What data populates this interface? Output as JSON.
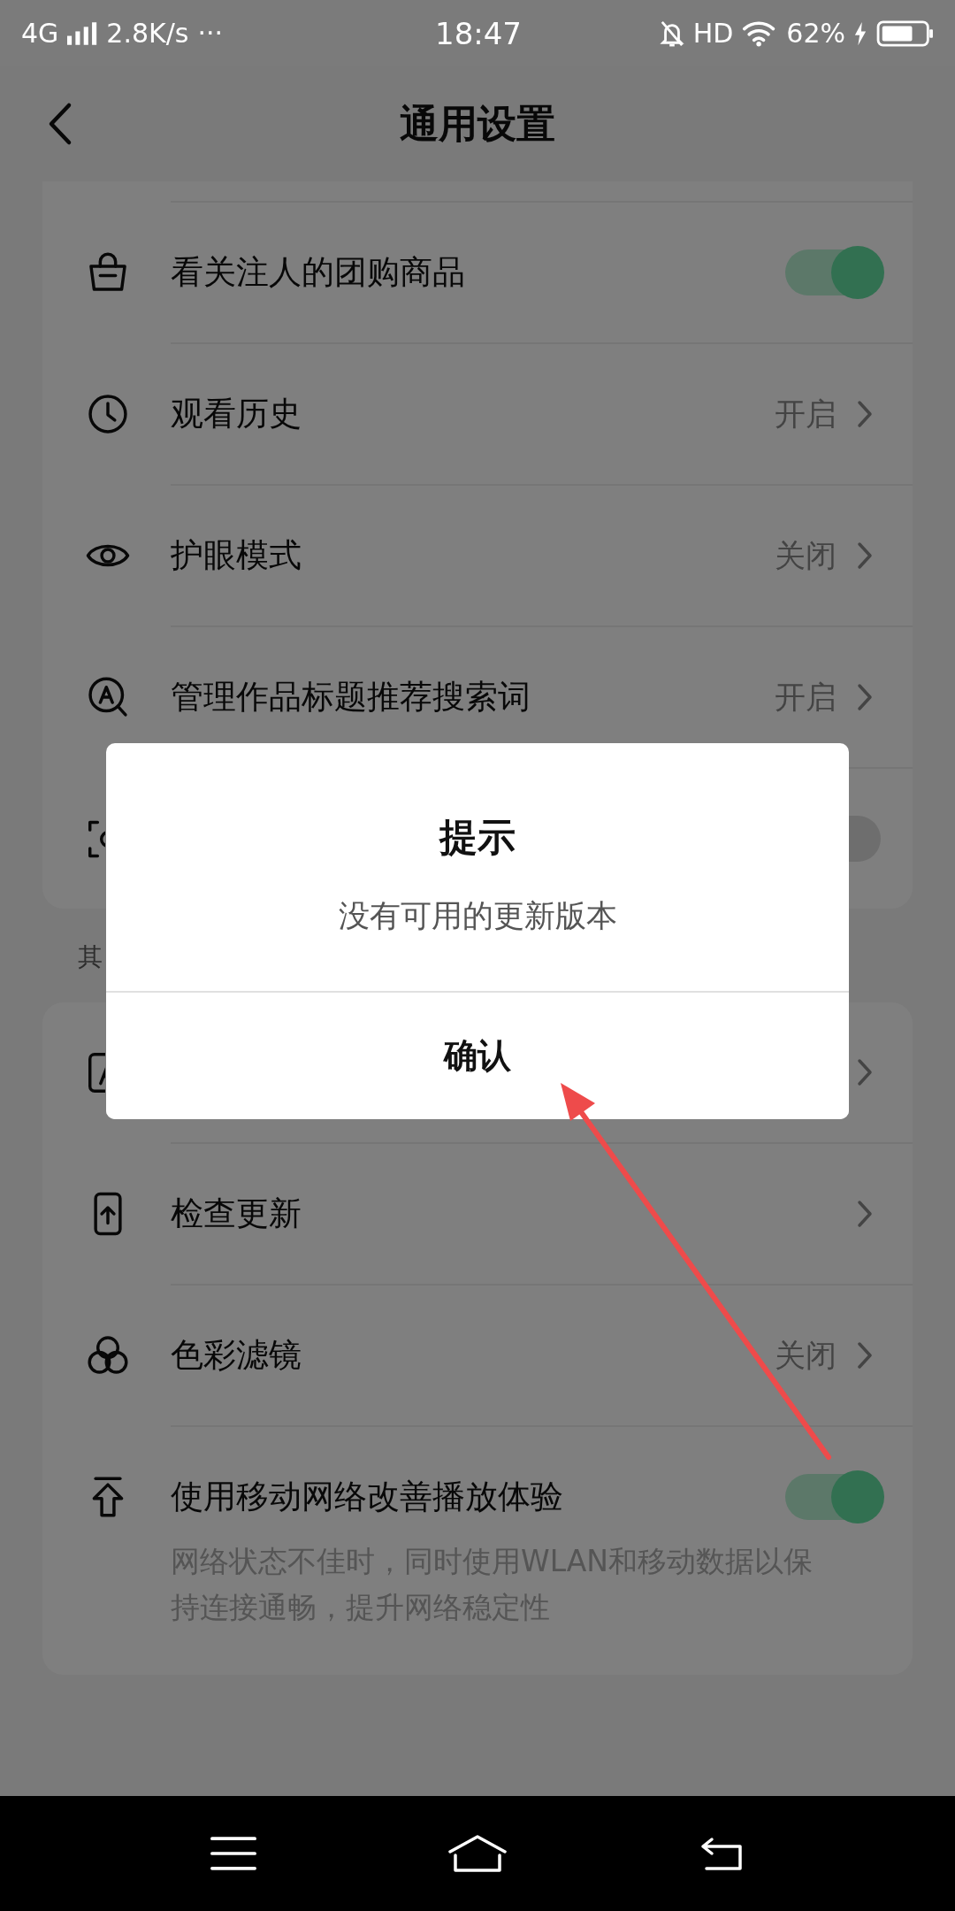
{
  "status_bar": {
    "network": "4G",
    "speed": "2.8K/s",
    "more": "···",
    "time": "18:47",
    "hd": "HD",
    "battery": "62%"
  },
  "header": {
    "title": "通用设置"
  },
  "sections": [
    {
      "rows": [
        {
          "kind": "toggle",
          "label": "看关注人的团购商品",
          "on": true
        },
        {
          "kind": "link",
          "label": "观看历史",
          "value": "开启"
        },
        {
          "kind": "link",
          "label": "护眼模式",
          "value": "关闭"
        },
        {
          "kind": "link",
          "label": "管理作品标题推荐搜索词",
          "value": "开启"
        },
        {
          "kind": "toggle",
          "on": false
        }
      ]
    },
    {
      "label": "其",
      "rows": [
        {
          "kind": "link"
        },
        {
          "kind": "link",
          "label": "检查更新"
        },
        {
          "kind": "link",
          "label": "色彩滤镜",
          "value": "关闭"
        },
        {
          "kind": "toggle",
          "label": "使用移动网络改善播放体验",
          "on": true,
          "description": "网络状态不佳时，同时使用WLAN和移动数据以保持连接通畅，提升网络稳定性"
        }
      ]
    }
  ],
  "dialog": {
    "title": "提示",
    "message": "没有可用的更新版本",
    "button": "确认"
  }
}
